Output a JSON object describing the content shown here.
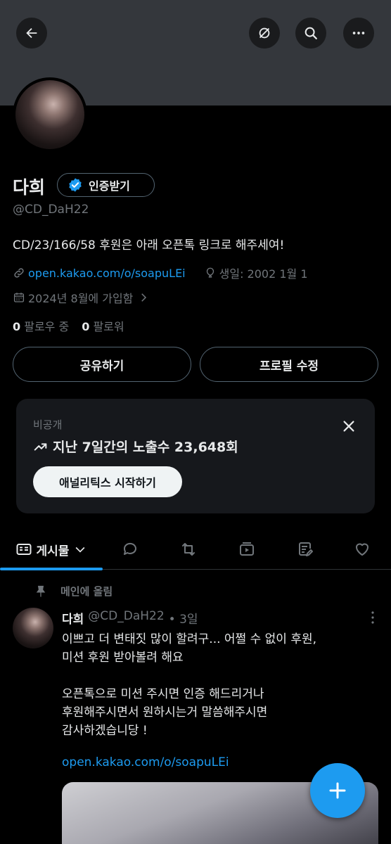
{
  "header": {
    "back_icon": "arrow-left-icon",
    "translate_icon": "translate-icon",
    "search_icon": "search-icon",
    "more_icon": "more-horizontal-icon"
  },
  "profile": {
    "name": "다희",
    "verify_label": "인증받기",
    "handle": "@CD_DaH22",
    "bio": "CD/23/166/58 후원은 아래 오픈톡 링크로 해주세여!",
    "link": "open.kakao.com/o/soapuLEi",
    "birthday": "생일: 2002 1월 1",
    "joined": "2024년 8월에 가입함",
    "following_count": "0",
    "following_label": "팔로우 중",
    "followers_count": "0",
    "followers_label": "팔로워"
  },
  "actions": {
    "share_label": "공유하기",
    "edit_label": "프로필 수정"
  },
  "analytics_card": {
    "private_label": "비공개",
    "impressions_text": "지난 7일간의 노출수 23,648회",
    "button_label": "애널리틱스 시작하기"
  },
  "tabs": {
    "active_label": "게시물"
  },
  "post": {
    "pinned_label": "메인에 올림",
    "author_name": "다희",
    "author_handle": "@CD_DaH22",
    "time": "• 3일",
    "text_line1": "이쁘고 더 변태짓 많이 할려구... 어쩔 수 없이 후원,",
    "text_line2": "미션 후원 받아볼려 해요",
    "text_line3": "오픈톡으로 미션 주시면 인증 해드리거나",
    "text_line4": "후원해주시면서 원하시는거 말씀해주시면",
    "text_line5": "감사하겠습니당 !",
    "link": "open.kakao.com/o/soapuLEi"
  },
  "colors": {
    "accent": "#1d9bf0",
    "background": "#000000",
    "banner": "#34373c"
  }
}
